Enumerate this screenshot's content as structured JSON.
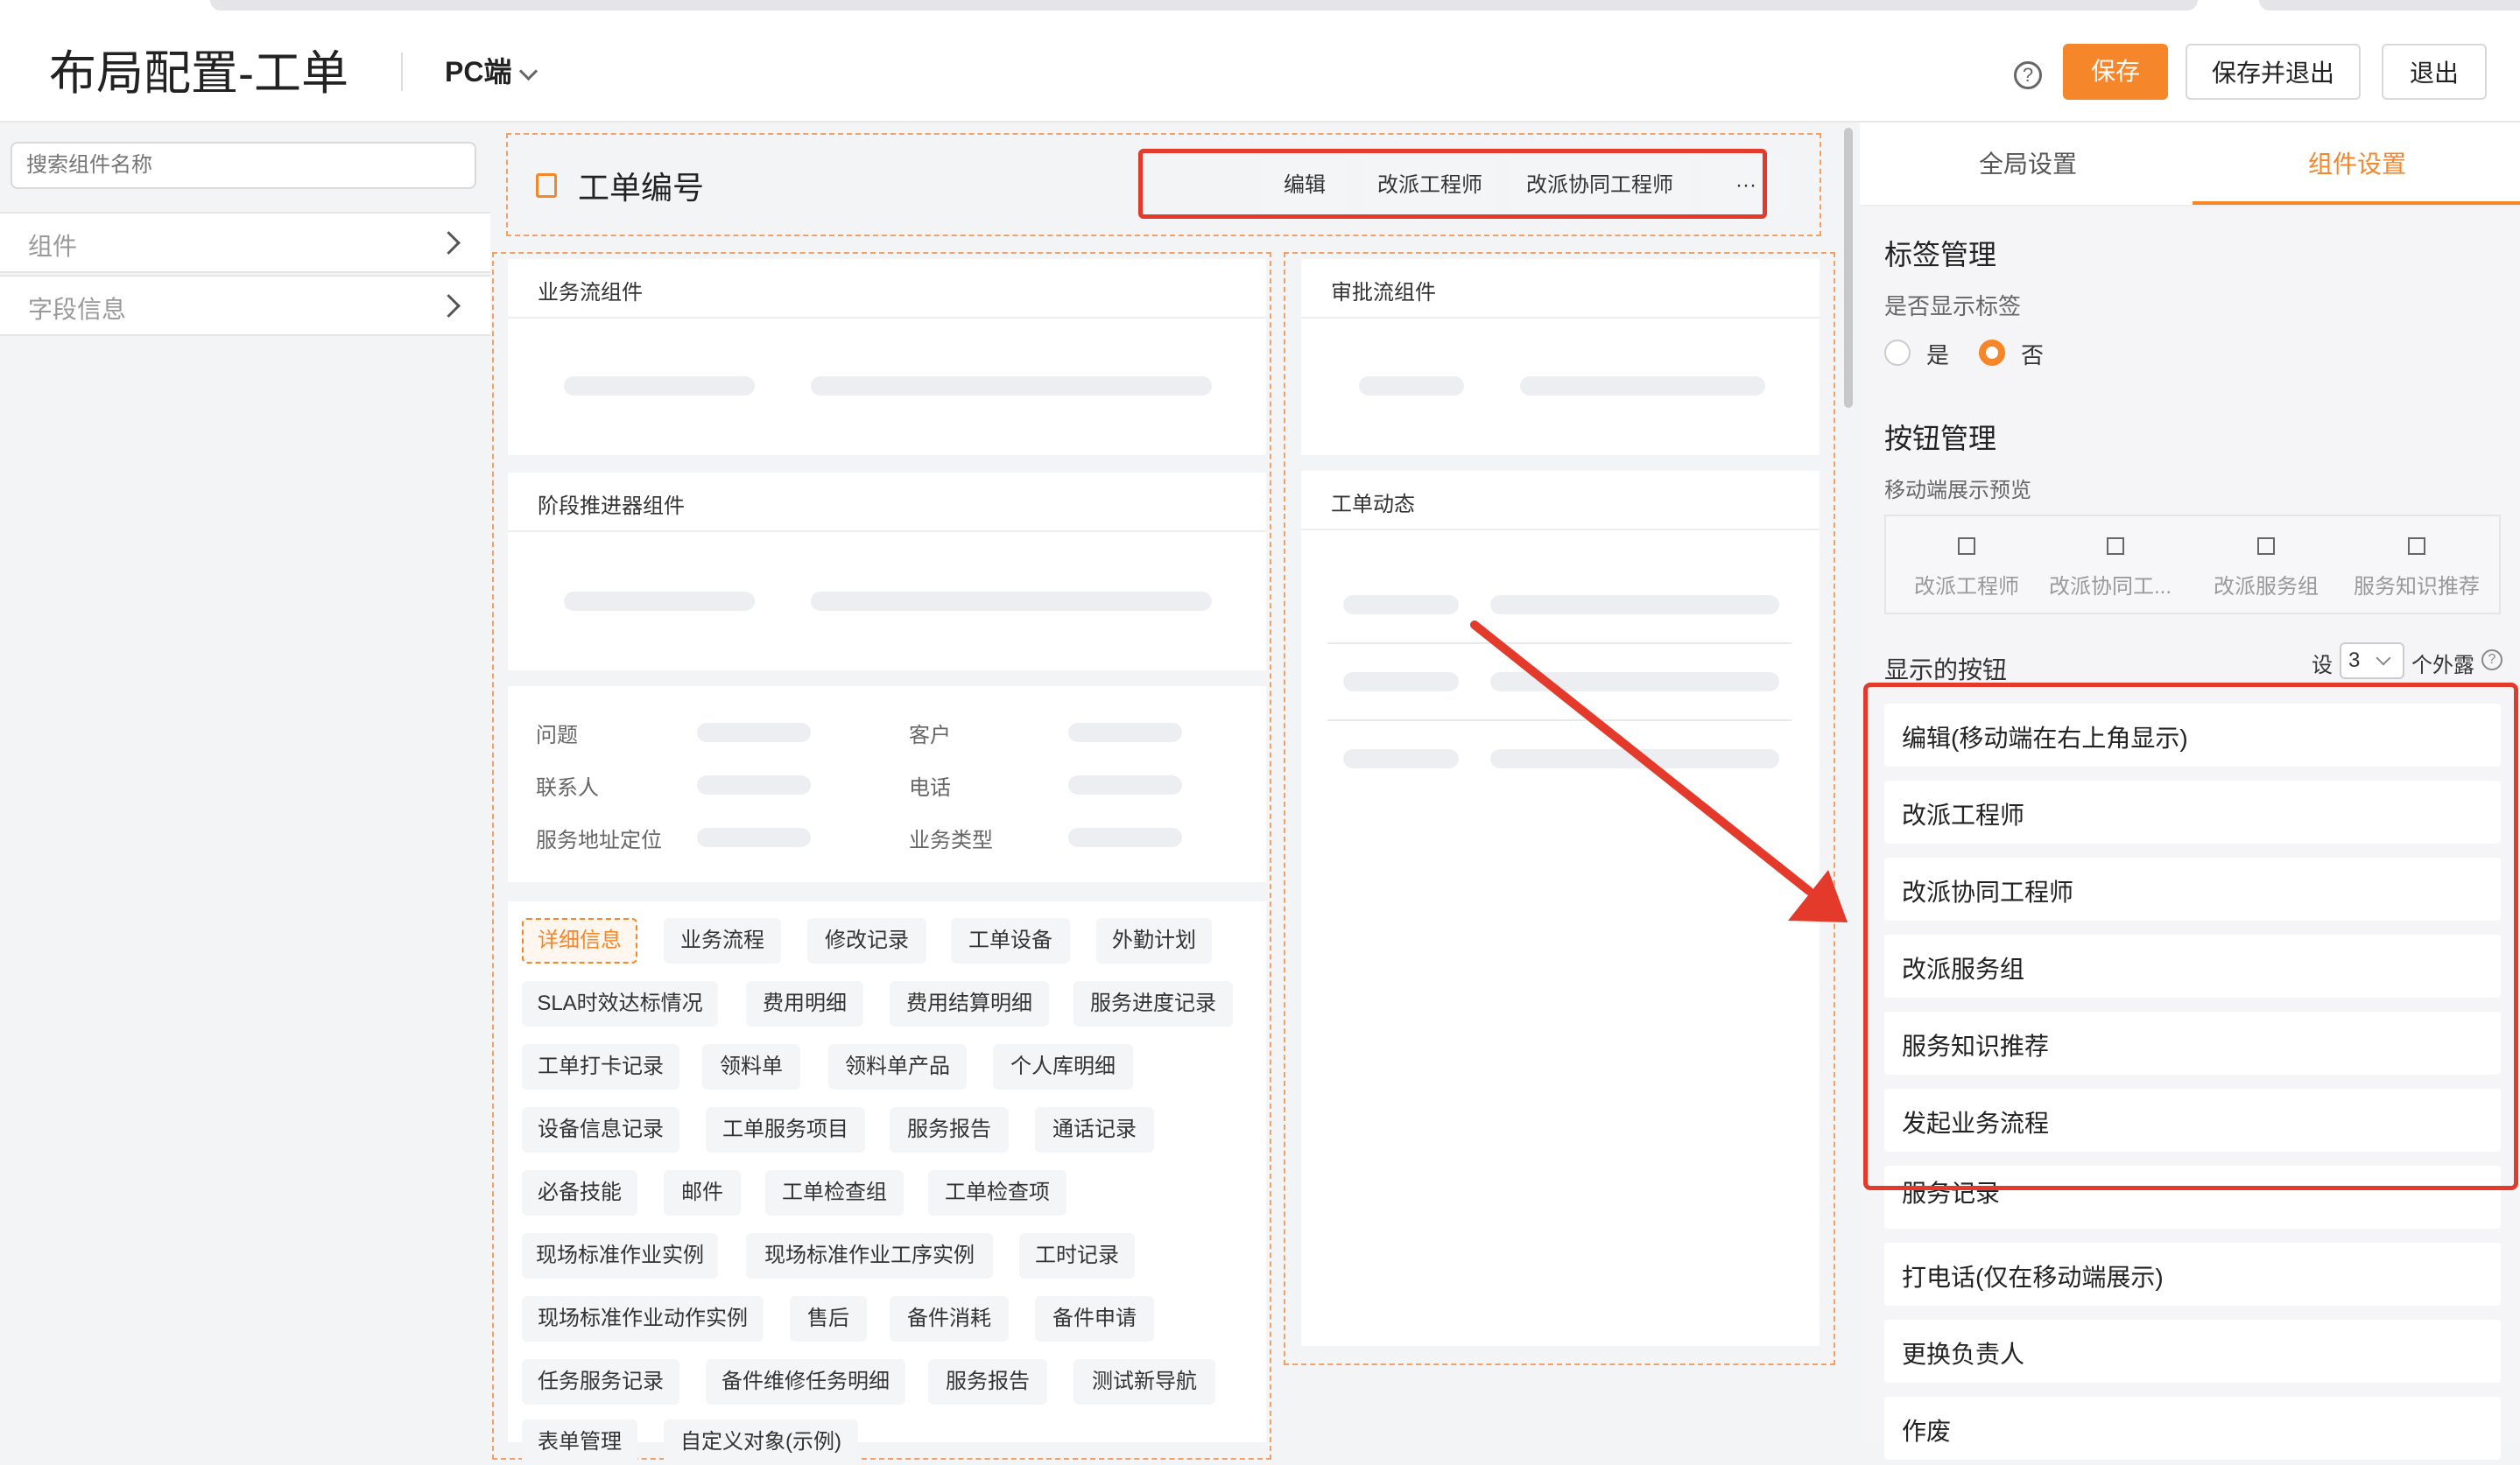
{
  "header": {
    "title": "布局配置-工单",
    "platform": "PC端",
    "help_icon": "?",
    "buttons": {
      "save": "保存",
      "save_exit": "保存并退出",
      "exit": "退出"
    }
  },
  "sidebar": {
    "search_placeholder": "搜索组件名称",
    "items": [
      {
        "label": "组件"
      },
      {
        "label": "字段信息"
      }
    ]
  },
  "canvas": {
    "work_order_title": "工单编号",
    "toolbar": [
      "编辑",
      "改派工程师",
      "改派协同工程师",
      "···"
    ],
    "cards": {
      "business_flow": "业务流组件",
      "approval_flow": "审批流组件",
      "stage_advancer": "阶段推进器组件",
      "work_order_dynamics": "工单动态"
    },
    "fields": [
      "问题",
      "客户",
      "联系人",
      "电话",
      "服务地址定位",
      "业务类型"
    ],
    "tags": [
      "详细信息",
      "业务流程",
      "修改记录",
      "工单设备",
      "外勤计划",
      "SLA时效达标情况",
      "费用明细",
      "费用结算明细",
      "服务进度记录",
      "工单打卡记录",
      "领料单",
      "领料单产品",
      "个人库明细",
      "设备信息记录",
      "工单服务项目",
      "服务报告",
      "通话记录",
      "必备技能",
      "邮件",
      "工单检查组",
      "工单检查项",
      "现场标准作业实例",
      "现场标准作业工序实例",
      "工时记录",
      "现场标准作业动作实例",
      "售后",
      "备件消耗",
      "备件申请",
      "任务服务记录",
      "备件维修任务明细",
      "服务报告",
      "测试新导航",
      "表单管理",
      "自定义对象(示例)"
    ]
  },
  "right": {
    "tabs": [
      "全局设置",
      "组件设置"
    ],
    "active_tab": 1,
    "tag_section": {
      "title": "标签管理",
      "question": "是否显示标签",
      "options": [
        "是",
        "否"
      ],
      "selected": 1
    },
    "button_section": {
      "title": "按钮管理",
      "preview_title": "移动端展示预览",
      "preview_buttons": [
        "改派工程师",
        "改派协同工...",
        "改派服务组",
        "服务知识推荐"
      ],
      "shown_title": "显示的按钮",
      "setting_prefix": "设",
      "exposed_count": "3",
      "setting_suffix": "个外露",
      "list": [
        "编辑(移动端在右上角显示)",
        "改派工程师",
        "改派协同工程师",
        "改派服务组",
        "服务知识推荐",
        "发起业务流程",
        "服务记录",
        "打电话(仅在移动端展示)",
        "更换负责人",
        "作废"
      ]
    }
  },
  "colors": {
    "accent": "#f5862a",
    "annotation_red": "#e33a2c"
  }
}
